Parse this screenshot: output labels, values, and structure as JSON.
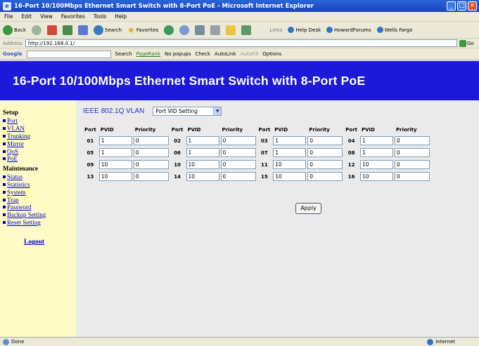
{
  "window": {
    "title": "16-Port 10/100Mbps Ethernet Smart Switch with 8-Port PoE - Microsoft Internet Explorer"
  },
  "menu": [
    "File",
    "Edit",
    "View",
    "Favorites",
    "Tools",
    "Help"
  ],
  "toolbar": {
    "back": "Back",
    "search": "Search",
    "favorites": "Favorites",
    "links_label": "Links",
    "links": [
      "Help Desk",
      "HowardForums",
      "Wells Fargo"
    ]
  },
  "address": {
    "label": "Address",
    "url": "http://192.168.0.1/",
    "go": "Go"
  },
  "googlebar": {
    "brand": "Google",
    "search": "Search",
    "pagerank": "PageRank",
    "popups": "No popups",
    "check": "Check",
    "autolink": "AutoLink",
    "autofill": "AutoFill",
    "options": "Options"
  },
  "banner": {
    "title": "16-Port 10/100Mbps Ethernet Smart Switch with 8-Port PoE"
  },
  "sidebar": {
    "setup_heading": "Setup",
    "setup_items": [
      "Port",
      "VLAN",
      "Trunking",
      "Mirror",
      "QoS",
      "PoE"
    ],
    "maintenance_heading": "Maintenance",
    "maintenance_items": [
      "Status",
      "Statistics",
      "System",
      "Trap",
      "Password",
      "Backup Setting",
      "Reset Setting"
    ],
    "logout": "Logout"
  },
  "vlan": {
    "label": "IEEE 802.1Q VLAN",
    "mode_selected": "Port VID Setting"
  },
  "table": {
    "headers": [
      "Port",
      "PVID",
      "Priority",
      "Port",
      "PVID",
      "Priority",
      "Port",
      "PVID",
      "Priority",
      "Port",
      "PVID",
      "Priority"
    ],
    "rows": [
      [
        {
          "port": "01",
          "pvid": "1",
          "priority": "0"
        },
        {
          "port": "02",
          "pvid": "1",
          "priority": "0"
        },
        {
          "port": "03",
          "pvid": "1",
          "priority": "0"
        },
        {
          "port": "04",
          "pvid": "1",
          "priority": "0"
        }
      ],
      [
        {
          "port": "05",
          "pvid": "1",
          "priority": "0"
        },
        {
          "port": "06",
          "pvid": "1",
          "priority": "0"
        },
        {
          "port": "07",
          "pvid": "1",
          "priority": "0"
        },
        {
          "port": "08",
          "pvid": "1",
          "priority": "0"
        }
      ],
      [
        {
          "port": "09",
          "pvid": "10",
          "priority": "0"
        },
        {
          "port": "10",
          "pvid": "10",
          "priority": "0"
        },
        {
          "port": "11",
          "pvid": "10",
          "priority": "0"
        },
        {
          "port": "12",
          "pvid": "10",
          "priority": "0"
        }
      ],
      [
        {
          "port": "13",
          "pvid": "10",
          "priority": "0"
        },
        {
          "port": "14",
          "pvid": "10",
          "priority": "0"
        },
        {
          "port": "15",
          "pvid": "10",
          "priority": "0"
        },
        {
          "port": "16",
          "pvid": "10",
          "priority": "0"
        }
      ]
    ]
  },
  "apply_label": "Apply",
  "status": {
    "left": "Done",
    "zone": "Internet"
  }
}
